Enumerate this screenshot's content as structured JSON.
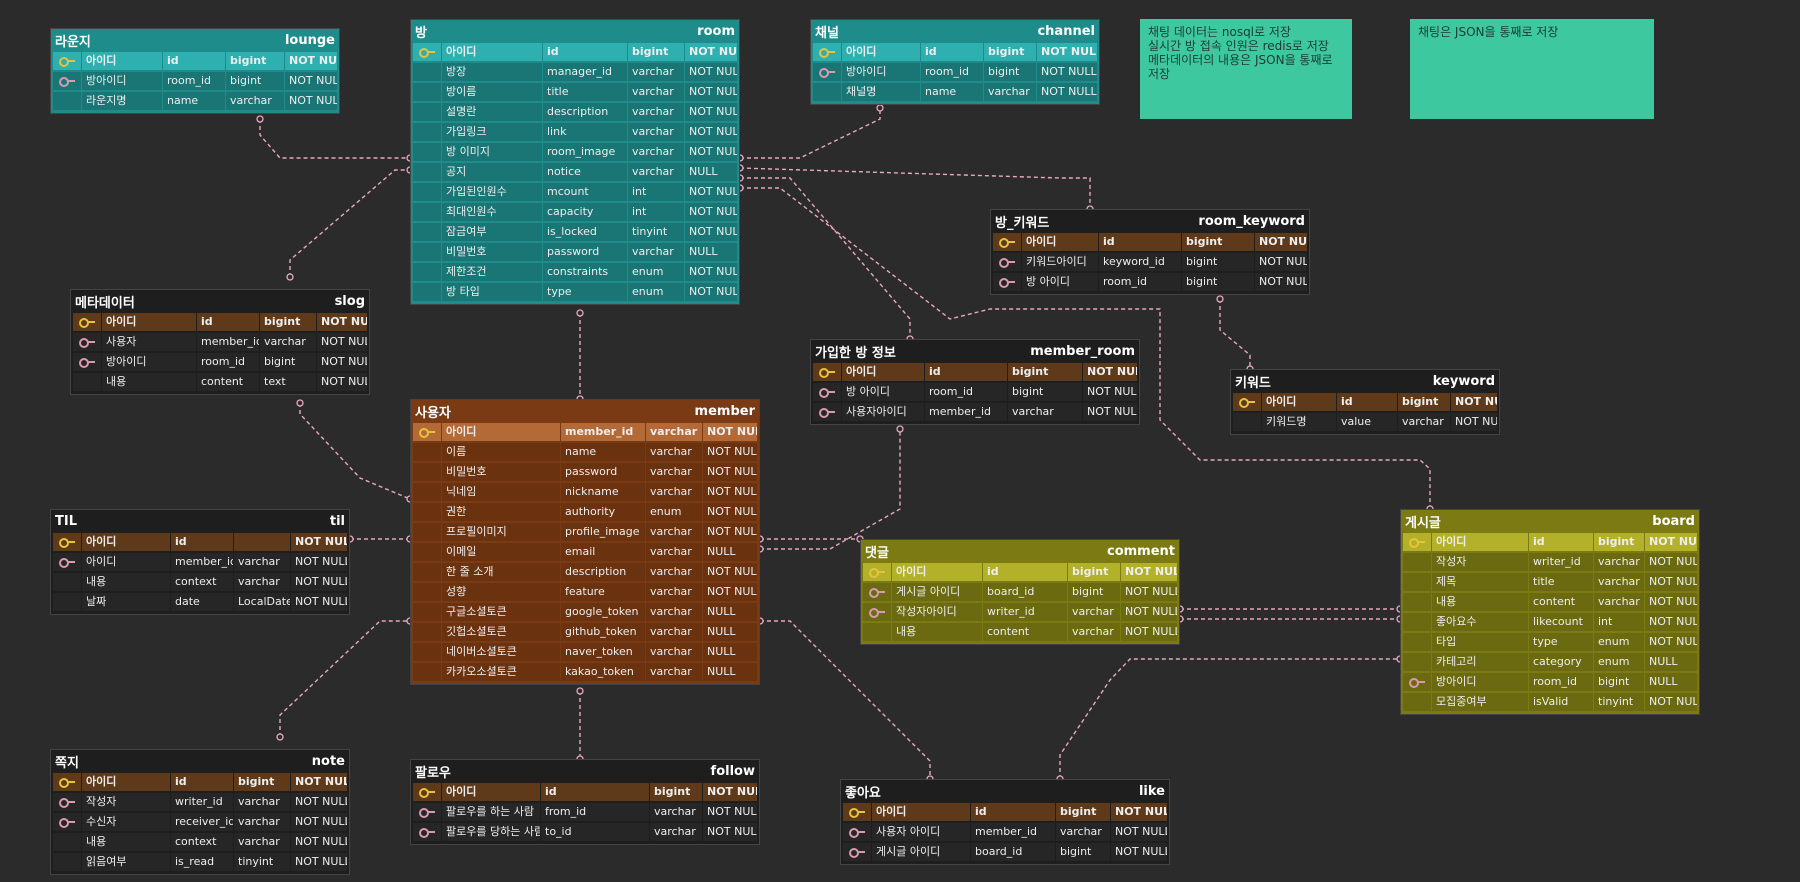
{
  "colors": {
    "background": "#2b2b2b",
    "teal": "#1f8c8c",
    "teal_pk": "#2fb0b0",
    "brown": "#7a3a14",
    "brown_pk": "#b36a37",
    "olive": "#7c7a12",
    "olive_pk": "#b3b02a",
    "dark": "#1e1e1e",
    "dark_pk": "#5e3a1a",
    "note": "#3ec8a0",
    "edge": "#e8a8c0",
    "pk_icon": "#e8c23a",
    "fk_icon": "#d89ab0"
  },
  "notes": [
    {
      "id": "note-storage",
      "text": "채팅 데이터는 nosql로 저장\n실시간 방 접속 인원은 redis로 저장\n메타데이터의 내용은 JSON을 통째로 저장"
    },
    {
      "id": "note-json",
      "text": "채팅은 JSON을 통째로 저장"
    }
  ],
  "tables": {
    "lounge": {
      "ko": "라운지",
      "en": "lounge",
      "theme": "teal",
      "columns": [
        {
          "key": "pk",
          "ko": "아이디",
          "name": "id",
          "type": "bigint",
          "null": "NOT NULL"
        },
        {
          "key": "fk",
          "ko": "방아이디",
          "name": "room_id",
          "type": "bigint",
          "null": "NOT NULL"
        },
        {
          "key": "",
          "ko": "라운지명",
          "name": "name",
          "type": "varchar",
          "null": "NOT NULL"
        }
      ]
    },
    "room": {
      "ko": "방",
      "en": "room",
      "theme": "teal",
      "columns": [
        {
          "key": "pk",
          "ko": "아이디",
          "name": "id",
          "type": "bigint",
          "null": "NOT NULL"
        },
        {
          "key": "",
          "ko": "방장",
          "name": "manager_id",
          "type": "varchar",
          "null": "NOT NULL"
        },
        {
          "key": "",
          "ko": "방이름",
          "name": "title",
          "type": "varchar",
          "null": "NOT NULL"
        },
        {
          "key": "",
          "ko": "설명란",
          "name": "description",
          "type": "varchar",
          "null": "NOT NULL"
        },
        {
          "key": "",
          "ko": "가입링크",
          "name": "link",
          "type": "varchar",
          "null": "NOT NULL"
        },
        {
          "key": "",
          "ko": "방 이미지",
          "name": "room_image",
          "type": "varchar",
          "null": "NOT NULL"
        },
        {
          "key": "",
          "ko": "공지",
          "name": "notice",
          "type": "varchar",
          "null": "NULL"
        },
        {
          "key": "",
          "ko": "가입된인원수",
          "name": "mcount",
          "type": "int",
          "null": "NOT NULL"
        },
        {
          "key": "",
          "ko": "최대인원수",
          "name": "capacity",
          "type": "int",
          "null": "NOT NULL"
        },
        {
          "key": "",
          "ko": "잠금여부",
          "name": "is_locked",
          "type": "tinyint",
          "null": "NOT NULL"
        },
        {
          "key": "",
          "ko": "비밀번호",
          "name": "password",
          "type": "varchar",
          "null": "NULL"
        },
        {
          "key": "",
          "ko": "제한조건",
          "name": "constraints",
          "type": "enum",
          "null": "NOT NULL"
        },
        {
          "key": "",
          "ko": "방 타입",
          "name": "type",
          "type": "enum",
          "null": "NOT NULL"
        }
      ]
    },
    "channel": {
      "ko": "채널",
      "en": "channel",
      "theme": "teal",
      "columns": [
        {
          "key": "pk",
          "ko": "아이디",
          "name": "id",
          "type": "bigint",
          "null": "NOT NULL"
        },
        {
          "key": "fk",
          "ko": "방아이디",
          "name": "room_id",
          "type": "bigint",
          "null": "NOT NULL"
        },
        {
          "key": "",
          "ko": "채널명",
          "name": "name",
          "type": "varchar",
          "null": "NOT NULL"
        }
      ]
    },
    "room_keyword": {
      "ko": "방_키워드",
      "en": "room_keyword",
      "theme": "dark",
      "columns": [
        {
          "key": "pk",
          "ko": "아이디",
          "name": "id",
          "type": "bigint",
          "null": "NOT NULL"
        },
        {
          "key": "fk",
          "ko": "키워드아이디",
          "name": "keyword_id",
          "type": "bigint",
          "null": "NOT NULL"
        },
        {
          "key": "fk",
          "ko": "방 아이디",
          "name": "room_id",
          "type": "bigint",
          "null": "NOT NULL"
        }
      ]
    },
    "keyword": {
      "ko": "키워드",
      "en": "keyword",
      "theme": "dark",
      "columns": [
        {
          "key": "pk",
          "ko": "아이디",
          "name": "id",
          "type": "bigint",
          "null": "NOT NULL"
        },
        {
          "key": "",
          "ko": "키워드명",
          "name": "value",
          "type": "varchar",
          "null": "NOT NULL"
        }
      ]
    },
    "slog": {
      "ko": "메타데이터",
      "en": "slog",
      "theme": "dark",
      "columns": [
        {
          "key": "pk",
          "ko": "아이디",
          "name": "id",
          "type": "bigint",
          "null": "NOT NULL"
        },
        {
          "key": "fk",
          "ko": "사용자",
          "name": "member_id",
          "type": "varchar",
          "null": "NOT NULL"
        },
        {
          "key": "fk",
          "ko": "방아이디",
          "name": "room_id",
          "type": "bigint",
          "null": "NOT NULL"
        },
        {
          "key": "",
          "ko": "내용",
          "name": "content",
          "type": "text",
          "null": "NOT NULL"
        }
      ]
    },
    "member_room": {
      "ko": "가입한 방 정보",
      "en": "member_room",
      "theme": "dark",
      "columns": [
        {
          "key": "pk",
          "ko": "아이디",
          "name": "id",
          "type": "bigint",
          "null": "NOT NULL"
        },
        {
          "key": "fk",
          "ko": "방 아이디",
          "name": "room_id",
          "type": "bigint",
          "null": "NOT NULL"
        },
        {
          "key": "fk",
          "ko": "사용자아이디",
          "name": "member_id",
          "type": "varchar",
          "null": "NOT NULL"
        }
      ]
    },
    "member": {
      "ko": "사용자",
      "en": "member",
      "theme": "brown",
      "columns": [
        {
          "key": "pk",
          "ko": "아이디",
          "name": "member_id",
          "type": "varchar",
          "null": "NOT NULL"
        },
        {
          "key": "",
          "ko": "이름",
          "name": "name",
          "type": "varchar",
          "null": "NOT NULL"
        },
        {
          "key": "",
          "ko": "비밀번호",
          "name": "password",
          "type": "varchar",
          "null": "NOT NULL"
        },
        {
          "key": "",
          "ko": "닉네임",
          "name": "nickname",
          "type": "varchar",
          "null": "NOT NULL"
        },
        {
          "key": "",
          "ko": "권한",
          "name": "authority",
          "type": "enum",
          "null": "NOT NULL"
        },
        {
          "key": "",
          "ko": "프로필이미지",
          "name": "profile_image",
          "type": "varchar",
          "null": "NOT NULL"
        },
        {
          "key": "",
          "ko": "이메일",
          "name": "email",
          "type": "varchar",
          "null": "NULL"
        },
        {
          "key": "",
          "ko": "한 줄 소개",
          "name": "description",
          "type": "varchar",
          "null": "NOT NULL"
        },
        {
          "key": "",
          "ko": "성향",
          "name": "feature",
          "type": "varchar",
          "null": "NOT NULL"
        },
        {
          "key": "",
          "ko": "구글소셜토큰",
          "name": "google_token",
          "type": "varchar",
          "null": "NULL"
        },
        {
          "key": "",
          "ko": "깃헙소셜토큰",
          "name": "github_token",
          "type": "varchar",
          "null": "NULL"
        },
        {
          "key": "",
          "ko": "네이버소셜토큰",
          "name": "naver_token",
          "type": "varchar",
          "null": "NULL"
        },
        {
          "key": "",
          "ko": "카카오소셜토큰",
          "name": "kakao_token",
          "type": "varchar",
          "null": "NULL"
        }
      ]
    },
    "til": {
      "ko": "TIL",
      "en": "til",
      "theme": "dark",
      "columns": [
        {
          "key": "pk",
          "ko": "아이디",
          "name": "id",
          "type": "",
          "null": "NOT NULL"
        },
        {
          "key": "fk",
          "ko": "아이디",
          "name": "member_id",
          "type": "varchar",
          "null": "NOT NULL"
        },
        {
          "key": "",
          "ko": "내용",
          "name": "context",
          "type": "varchar",
          "null": "NOT NULL"
        },
        {
          "key": "",
          "ko": "날짜",
          "name": "date",
          "type": "LocalDate",
          "null": "NOT NULL"
        }
      ]
    },
    "comment": {
      "ko": "댓글",
      "en": "comment",
      "theme": "olive",
      "columns": [
        {
          "key": "pk",
          "ko": "아이디",
          "name": "id",
          "type": "bigint",
          "null": "NOT NULL"
        },
        {
          "key": "fk",
          "ko": "게시글 아이디",
          "name": "board_id",
          "type": "bigint",
          "null": "NOT NULL"
        },
        {
          "key": "fk",
          "ko": "작성자아이디",
          "name": "writer_id",
          "type": "varchar",
          "null": "NOT NULL"
        },
        {
          "key": "",
          "ko": "내용",
          "name": "content",
          "type": "varchar",
          "null": "NOT NULL"
        }
      ]
    },
    "board": {
      "ko": "게시글",
      "en": "board",
      "theme": "olive",
      "columns": [
        {
          "key": "pk",
          "ko": "아이디",
          "name": "id",
          "type": "bigint",
          "null": "NOT NULL"
        },
        {
          "key": "",
          "ko": "작성자",
          "name": "writer_id",
          "type": "varchar",
          "null": "NOT NULL"
        },
        {
          "key": "",
          "ko": "제목",
          "name": "title",
          "type": "varchar",
          "null": "NOT NULL"
        },
        {
          "key": "",
          "ko": "내용",
          "name": "content",
          "type": "varchar",
          "null": "NOT NULL"
        },
        {
          "key": "",
          "ko": "좋아요수",
          "name": "likecount",
          "type": "int",
          "null": "NOT NULL"
        },
        {
          "key": "",
          "ko": "타입",
          "name": "type",
          "type": "enum",
          "null": "NOT NULL"
        },
        {
          "key": "",
          "ko": "카테고리",
          "name": "category",
          "type": "enum",
          "null": "NULL"
        },
        {
          "key": "fk",
          "ko": "방아이디",
          "name": "room_id",
          "type": "bigint",
          "null": "NULL"
        },
        {
          "key": "",
          "ko": "모집중여부",
          "name": "isValid",
          "type": "tinyint",
          "null": "NOT NULL"
        }
      ]
    },
    "note": {
      "ko": "쪽지",
      "en": "note",
      "theme": "dark",
      "columns": [
        {
          "key": "pk",
          "ko": "아이디",
          "name": "id",
          "type": "bigint",
          "null": "NOT NULL"
        },
        {
          "key": "fk",
          "ko": "작성자",
          "name": "writer_id",
          "type": "varchar",
          "null": "NOT NULL"
        },
        {
          "key": "fk",
          "ko": "수신자",
          "name": "receiver_id",
          "type": "varchar",
          "null": "NOT NULL"
        },
        {
          "key": "",
          "ko": "내용",
          "name": "context",
          "type": "varchar",
          "null": "NOT NULL"
        },
        {
          "key": "",
          "ko": "읽음여부",
          "name": "is_read",
          "type": "tinyint",
          "null": "NOT NULL"
        }
      ]
    },
    "follow": {
      "ko": "팔로우",
      "en": "follow",
      "theme": "dark",
      "columns": [
        {
          "key": "pk",
          "ko": "아이디",
          "name": "id",
          "type": "bigint",
          "null": "NOT NULL"
        },
        {
          "key": "fk",
          "ko": "팔로우를 하는 사람",
          "name": "from_id",
          "type": "varchar",
          "null": "NOT NULL"
        },
        {
          "key": "fk",
          "ko": "팔로우를 당하는 사람",
          "name": "to_id",
          "type": "varchar",
          "null": "NOT NULL"
        }
      ]
    },
    "like": {
      "ko": "좋아요",
      "en": "like",
      "theme": "dark",
      "columns": [
        {
          "key": "pk",
          "ko": "아이디",
          "name": "id",
          "type": "bigint",
          "null": "NOT NULL"
        },
        {
          "key": "fk",
          "ko": "사용자 아이디",
          "name": "member_id",
          "type": "varchar",
          "null": "NOT NULL"
        },
        {
          "key": "fk",
          "ko": "게시글 아이디",
          "name": "board_id",
          "type": "bigint",
          "null": "NOT NULL"
        }
      ]
    }
  }
}
